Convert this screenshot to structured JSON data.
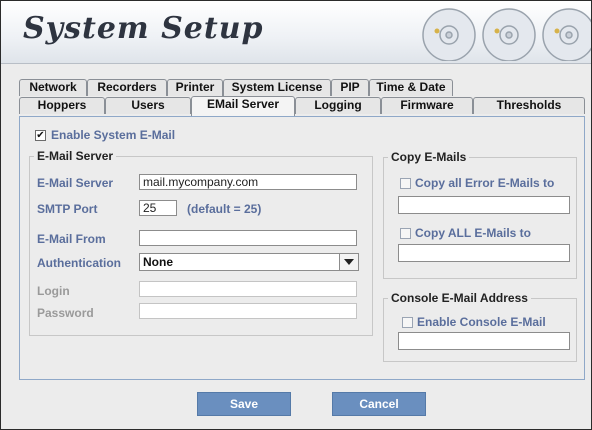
{
  "header": {
    "title": "System Setup"
  },
  "tabs": {
    "row1": [
      "Network",
      "Recorders",
      "Printer",
      "System License",
      "PIP",
      "Time & Date"
    ],
    "row2": [
      "Hoppers",
      "Users",
      "EMail Server",
      "Logging",
      "Firmware",
      "Thresholds"
    ],
    "active": "EMail Server"
  },
  "email": {
    "enable_label": "Enable System E-Mail",
    "enable_checked": true,
    "server_group": "E-Mail Server",
    "server_label": "E-Mail Server",
    "server_value": "mail.mycompany.com",
    "smtp_label": "SMTP Port",
    "smtp_value": "25",
    "smtp_hint": "(default = 25)",
    "from_label": "E-Mail From",
    "from_value": "",
    "auth_label": "Authentication",
    "auth_value": "None",
    "login_label": "Login",
    "login_value": "",
    "password_label": "Password",
    "password_value": ""
  },
  "copy": {
    "group": "Copy E-Mails",
    "errors_label": "Copy all Error E-Mails to",
    "errors_value": "",
    "all_label": "Copy ALL E-Mails to",
    "all_value": ""
  },
  "console": {
    "group": "Console E-Mail Address",
    "enable_label": "Enable Console E-Mail",
    "value": ""
  },
  "buttons": {
    "save": "Save",
    "cancel": "Cancel"
  }
}
